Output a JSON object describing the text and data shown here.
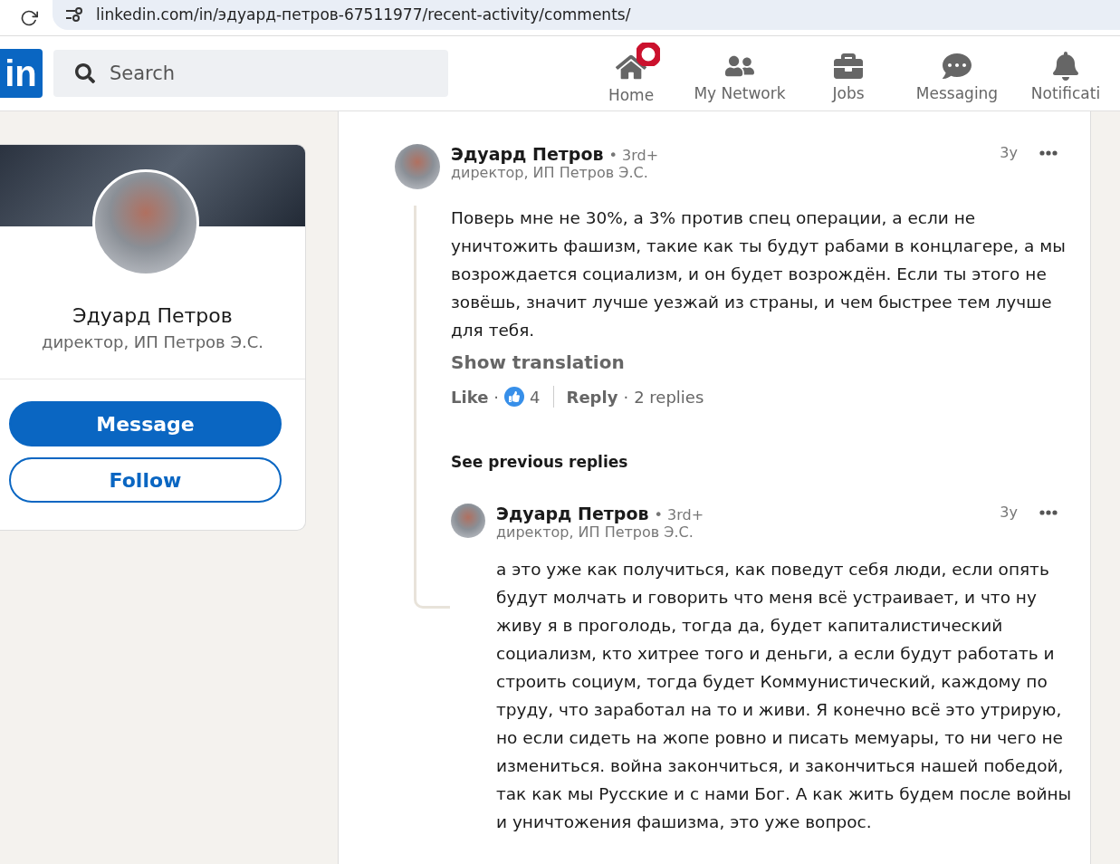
{
  "browser": {
    "url": "linkedin.com/in/эдуард-петров-67511977/recent-activity/comments/"
  },
  "nav": {
    "logo": "in",
    "search": {
      "placeholder": "Search"
    },
    "items": [
      {
        "kind": "home",
        "label": "Home",
        "badge": true
      },
      {
        "kind": "network",
        "label": "My Network",
        "badge": false
      },
      {
        "kind": "jobs",
        "label": "Jobs",
        "badge": false
      },
      {
        "kind": "messaging",
        "label": "Messaging",
        "badge": false
      },
      {
        "kind": "notifications",
        "label": "Notificati",
        "badge": false
      }
    ]
  },
  "profile_card": {
    "name": "Эдуард Петров",
    "headline": "директор, ИП Петров Э.С.",
    "buttons": [
      {
        "kind": "primary",
        "label": "Message"
      },
      {
        "kind": "outline",
        "label": "Follow"
      }
    ]
  },
  "comment": {
    "author": "Эдуард Петров",
    "degree": "• 3rd+",
    "headline": "директор, ИП Петров Э.С.",
    "time": "3y",
    "text": "Поверь мне не 30%, а 3% против спец операции, а если не уничтожить фашизм, такие как ты будут рабами в концлагере, а мы возрождается социализм, и он будет возрождён. Если ты этого не зовёшь, значит лучше уезжай из страны, и чем быстрее тем лучше для тебя.",
    "show_translation": "Show translation",
    "like": "Like",
    "dot1": "·",
    "like_count": "4",
    "reply": "Reply",
    "dot2": "·",
    "replies": "2 replies"
  },
  "see_previous": "See previous replies",
  "reply": {
    "author": "Эдуард Петров",
    "degree": "• 3rd+",
    "headline": "директор, ИП Петров Э.С.",
    "time": "3y",
    "text": "а это уже как получиться, как поведут себя люди, если опять будут молчать и говорить что меня всё устраивает, и что ну живу я в проголодь, тогда да, будет капиталистический социализм, кто хитрее того и деньги, а если будут работать и строить социум, тогда будет Коммунистический, каждому по труду, что заработал на то и живи. Я конечно всё это утрирую, но если сидеть на жопе ровно и писать мемуары, то ни чего не измениться. война закончиться, и закончиться нашей победой, так как мы Русские и с нами Бог. А как жить будем после войны и уничтожения фашизма, это уже вопрос."
  }
}
